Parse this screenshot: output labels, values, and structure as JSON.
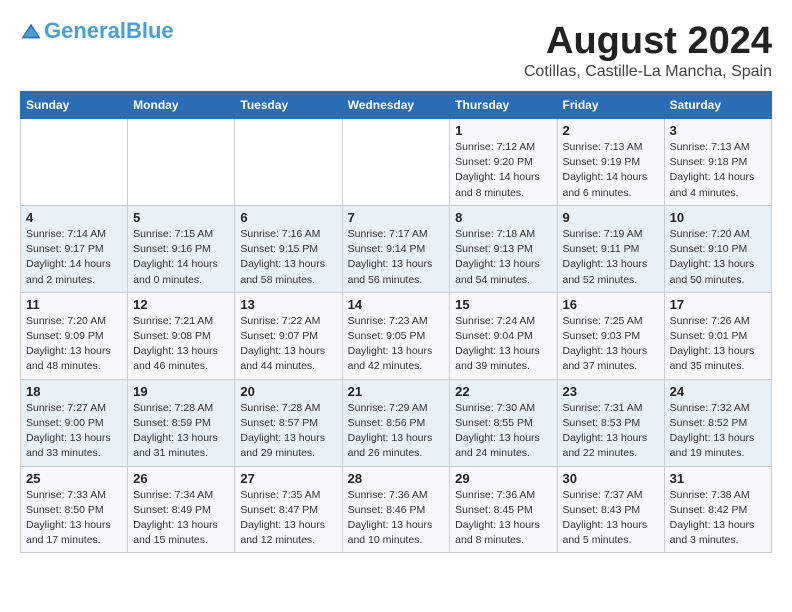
{
  "header": {
    "logo_general": "General",
    "logo_blue": "Blue",
    "month_year": "August 2024",
    "location": "Cotillas, Castille-La Mancha, Spain"
  },
  "columns": [
    "Sunday",
    "Monday",
    "Tuesday",
    "Wednesday",
    "Thursday",
    "Friday",
    "Saturday"
  ],
  "weeks": [
    [
      {
        "day": "",
        "info": ""
      },
      {
        "day": "",
        "info": ""
      },
      {
        "day": "",
        "info": ""
      },
      {
        "day": "",
        "info": ""
      },
      {
        "day": "1",
        "info": "Sunrise: 7:12 AM\nSunset: 9:20 PM\nDaylight: 14 hours\nand 8 minutes."
      },
      {
        "day": "2",
        "info": "Sunrise: 7:13 AM\nSunset: 9:19 PM\nDaylight: 14 hours\nand 6 minutes."
      },
      {
        "day": "3",
        "info": "Sunrise: 7:13 AM\nSunset: 9:18 PM\nDaylight: 14 hours\nand 4 minutes."
      }
    ],
    [
      {
        "day": "4",
        "info": "Sunrise: 7:14 AM\nSunset: 9:17 PM\nDaylight: 14 hours\nand 2 minutes."
      },
      {
        "day": "5",
        "info": "Sunrise: 7:15 AM\nSunset: 9:16 PM\nDaylight: 14 hours\nand 0 minutes."
      },
      {
        "day": "6",
        "info": "Sunrise: 7:16 AM\nSunset: 9:15 PM\nDaylight: 13 hours\nand 58 minutes."
      },
      {
        "day": "7",
        "info": "Sunrise: 7:17 AM\nSunset: 9:14 PM\nDaylight: 13 hours\nand 56 minutes."
      },
      {
        "day": "8",
        "info": "Sunrise: 7:18 AM\nSunset: 9:13 PM\nDaylight: 13 hours\nand 54 minutes."
      },
      {
        "day": "9",
        "info": "Sunrise: 7:19 AM\nSunset: 9:11 PM\nDaylight: 13 hours\nand 52 minutes."
      },
      {
        "day": "10",
        "info": "Sunrise: 7:20 AM\nSunset: 9:10 PM\nDaylight: 13 hours\nand 50 minutes."
      }
    ],
    [
      {
        "day": "11",
        "info": "Sunrise: 7:20 AM\nSunset: 9:09 PM\nDaylight: 13 hours\nand 48 minutes."
      },
      {
        "day": "12",
        "info": "Sunrise: 7:21 AM\nSunset: 9:08 PM\nDaylight: 13 hours\nand 46 minutes."
      },
      {
        "day": "13",
        "info": "Sunrise: 7:22 AM\nSunset: 9:07 PM\nDaylight: 13 hours\nand 44 minutes."
      },
      {
        "day": "14",
        "info": "Sunrise: 7:23 AM\nSunset: 9:05 PM\nDaylight: 13 hours\nand 42 minutes."
      },
      {
        "day": "15",
        "info": "Sunrise: 7:24 AM\nSunset: 9:04 PM\nDaylight: 13 hours\nand 39 minutes."
      },
      {
        "day": "16",
        "info": "Sunrise: 7:25 AM\nSunset: 9:03 PM\nDaylight: 13 hours\nand 37 minutes."
      },
      {
        "day": "17",
        "info": "Sunrise: 7:26 AM\nSunset: 9:01 PM\nDaylight: 13 hours\nand 35 minutes."
      }
    ],
    [
      {
        "day": "18",
        "info": "Sunrise: 7:27 AM\nSunset: 9:00 PM\nDaylight: 13 hours\nand 33 minutes."
      },
      {
        "day": "19",
        "info": "Sunrise: 7:28 AM\nSunset: 8:59 PM\nDaylight: 13 hours\nand 31 minutes."
      },
      {
        "day": "20",
        "info": "Sunrise: 7:28 AM\nSunset: 8:57 PM\nDaylight: 13 hours\nand 29 minutes."
      },
      {
        "day": "21",
        "info": "Sunrise: 7:29 AM\nSunset: 8:56 PM\nDaylight: 13 hours\nand 26 minutes."
      },
      {
        "day": "22",
        "info": "Sunrise: 7:30 AM\nSunset: 8:55 PM\nDaylight: 13 hours\nand 24 minutes."
      },
      {
        "day": "23",
        "info": "Sunrise: 7:31 AM\nSunset: 8:53 PM\nDaylight: 13 hours\nand 22 minutes."
      },
      {
        "day": "24",
        "info": "Sunrise: 7:32 AM\nSunset: 8:52 PM\nDaylight: 13 hours\nand 19 minutes."
      }
    ],
    [
      {
        "day": "25",
        "info": "Sunrise: 7:33 AM\nSunset: 8:50 PM\nDaylight: 13 hours\nand 17 minutes."
      },
      {
        "day": "26",
        "info": "Sunrise: 7:34 AM\nSunset: 8:49 PM\nDaylight: 13 hours\nand 15 minutes."
      },
      {
        "day": "27",
        "info": "Sunrise: 7:35 AM\nSunset: 8:47 PM\nDaylight: 13 hours\nand 12 minutes."
      },
      {
        "day": "28",
        "info": "Sunrise: 7:36 AM\nSunset: 8:46 PM\nDaylight: 13 hours\nand 10 minutes."
      },
      {
        "day": "29",
        "info": "Sunrise: 7:36 AM\nSunset: 8:45 PM\nDaylight: 13 hours\nand 8 minutes."
      },
      {
        "day": "30",
        "info": "Sunrise: 7:37 AM\nSunset: 8:43 PM\nDaylight: 13 hours\nand 5 minutes."
      },
      {
        "day": "31",
        "info": "Sunrise: 7:38 AM\nSunset: 8:42 PM\nDaylight: 13 hours\nand 3 minutes."
      }
    ]
  ]
}
